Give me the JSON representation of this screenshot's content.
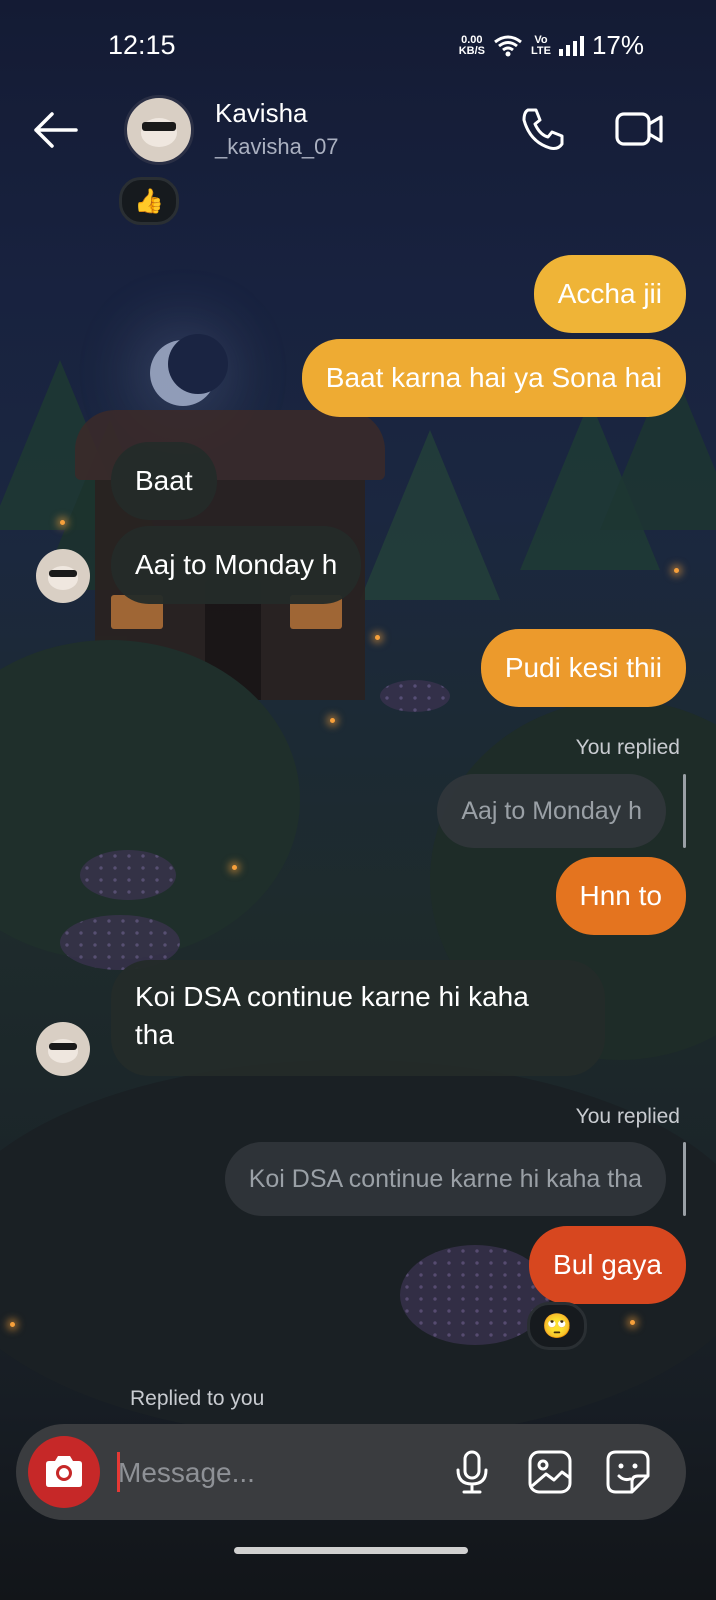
{
  "status_bar": {
    "time": "12:15",
    "net_speed_value": "0.00",
    "net_speed_unit": "KB/S",
    "volte_top": "Vo",
    "volte_bottom": "LTE",
    "battery": "17%"
  },
  "header": {
    "name": "Kavisha",
    "username": "_kavisha_07",
    "icons": [
      "back-arrow-icon",
      "phone-icon",
      "video-camera-icon"
    ]
  },
  "messages": [
    {
      "from": "them",
      "reaction": "👍"
    },
    {
      "from": "me",
      "text": "Accha jii"
    },
    {
      "from": "me",
      "text": "Baat karna hai ya Sona hai"
    },
    {
      "from": "them",
      "text": "Baat"
    },
    {
      "from": "them",
      "text": "Aaj to Monday h"
    },
    {
      "from": "me",
      "text": "Pudi kesi thii"
    },
    {
      "from": "me",
      "reply_label": "You replied",
      "quoted": "Aaj to Monday h",
      "text": "Hnn to"
    },
    {
      "from": "them",
      "text_line1": "Koi DSA continue karne hi kaha",
      "text_line2": "tha"
    },
    {
      "from": "me",
      "reply_label": "You replied",
      "quoted": "Koi DSA continue karne hi kaha tha",
      "text": "Bul gaya",
      "reaction": "🙄"
    },
    {
      "from": "them",
      "reply_label": "Replied to you"
    }
  ],
  "composer": {
    "placeholder": "Message...",
    "icons": [
      "camera-icon",
      "microphone-icon",
      "gallery-icon",
      "sticker-icon"
    ]
  },
  "colors": {
    "bubble_top": "#efb437",
    "bubble_mid": "#ec9a2c",
    "bubble_low": "#e4741f",
    "bubble_bottom": "#d7471f",
    "theirs_bubble": "#242b29",
    "camera_button": "#c62828"
  }
}
